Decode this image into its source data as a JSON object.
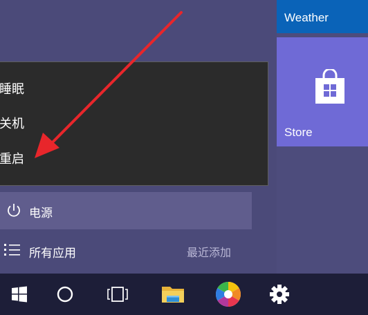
{
  "tiles": {
    "weather_label": "Weather",
    "store_label": "Store"
  },
  "power_menu": {
    "items": [
      {
        "label": "睡眠"
      },
      {
        "label": "关机"
      },
      {
        "label": "重启"
      }
    ]
  },
  "start_menu": {
    "power_label": "电源",
    "all_apps_label": "所有应用",
    "recently_added_label": "最近添加"
  },
  "taskbar": {
    "icons": [
      "windows-logo-icon",
      "search-circle-icon",
      "task-view-icon",
      "file-explorer-icon",
      "color-wheel-app-icon",
      "settings-gear-icon"
    ]
  },
  "colors": {
    "background": "#4b4a79",
    "weather_tile": "#0a63b8",
    "store_tile": "#6f6ad6",
    "power_menu": "#2b2b2b",
    "power_row_highlight": "#605d8d",
    "taskbar": "#1d1e38",
    "annotation_arrow": "#e8262b"
  }
}
